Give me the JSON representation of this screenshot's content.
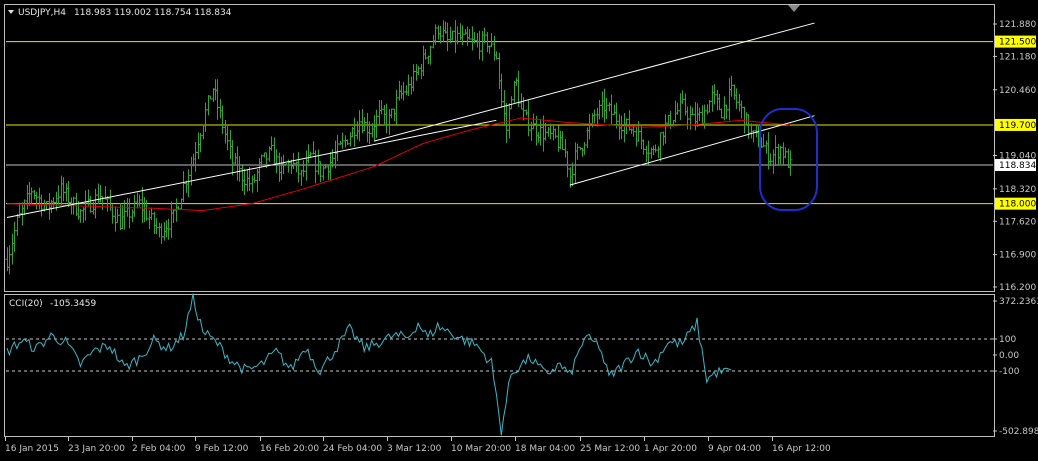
{
  "header": {
    "symbol_timeframe": "USDJPY,H4",
    "ohlc": "118.983 119.002 118.754 118.834"
  },
  "cci_header": {
    "label": "CCI(20)",
    "value": "-105.3459"
  },
  "colors": {
    "background": "#000000",
    "bars": "#2fa52f",
    "ma_line": "#e00000",
    "trend_lines": "#ffffff",
    "support_resistance": "#e6e600",
    "current_price_line": "#c0c0c0",
    "ellipse": "#1a2fd0",
    "cci_line": "#36b9c8",
    "cci_levels": "#c8c8c8",
    "axis_text": "#c8c8c8",
    "highlight_label_bg": "#ffff00",
    "current_label_bg": "#ffffff"
  },
  "chart_data": [
    {
      "type": "ohlc",
      "symbol": "USDJPY",
      "timeframe": "H4",
      "y_axis": {
        "range": [
          116.2,
          121.95
        ],
        "ticks": [
          "121.880",
          "121.180",
          "120.460",
          "119.040",
          "118.320",
          "117.620",
          "116.900",
          "116.200"
        ]
      },
      "x_axis": {
        "ticks": [
          "16 Jan 2015",
          "23 Jan 20:00",
          "2 Feb 04:00",
          "9 Feb 12:00",
          "16 Feb 20:00",
          "24 Feb 04:00",
          "3 Mar 12:00",
          "10 Mar 20:00",
          "18 Mar 04:00",
          "25 Mar 12:00",
          "1 Apr 20:00",
          "9 Apr 04:00",
          "16 Apr 12:00"
        ]
      },
      "horizontal_levels": [
        {
          "label": "121.500",
          "value": 121.5
        },
        {
          "label": "119.700",
          "value": 119.7
        },
        {
          "label": "118.000",
          "value": 118.0
        }
      ],
      "current_price": {
        "label": "118.834",
        "value": 118.834
      },
      "bars_count": 260,
      "price_path": [
        [
          0,
          116.8
        ],
        [
          4,
          117.6
        ],
        [
          10,
          118.3
        ],
        [
          16,
          117.9
        ],
        [
          22,
          118.3
        ],
        [
          30,
          117.8
        ],
        [
          38,
          118.2
        ],
        [
          46,
          117.6
        ],
        [
          54,
          118.0
        ],
        [
          62,
          117.4
        ],
        [
          68,
          117.7
        ],
        [
          72,
          118.4
        ],
        [
          76,
          119.0
        ],
        [
          80,
          119.8
        ],
        [
          84,
          120.5
        ],
        [
          88,
          119.7
        ],
        [
          92,
          118.9
        ],
        [
          96,
          118.6
        ],
        [
          100,
          118.4
        ],
        [
          104,
          118.9
        ],
        [
          108,
          119.1
        ],
        [
          112,
          118.7
        ],
        [
          116,
          118.9
        ],
        [
          120,
          118.6
        ],
        [
          124,
          119.0
        ],
        [
          128,
          118.7
        ],
        [
          132,
          118.9
        ],
        [
          136,
          119.2
        ],
        [
          140,
          119.5
        ],
        [
          144,
          119.8
        ],
        [
          148,
          119.6
        ],
        [
          152,
          119.9
        ],
        [
          156,
          119.8
        ],
        [
          160,
          120.3
        ],
        [
          164,
          120.5
        ],
        [
          168,
          120.9
        ],
        [
          172,
          121.3
        ],
        [
          176,
          121.8
        ],
        [
          180,
          121.5
        ],
        [
          184,
          121.6
        ],
        [
          188,
          121.5
        ],
        [
          192,
          121.45
        ],
        [
          196,
          121.5
        ],
        [
          200,
          121.2
        ],
        [
          202,
          120.2
        ],
        [
          204,
          119.6
        ],
        [
          206,
          120.4
        ],
        [
          208,
          120.6
        ],
        [
          210,
          120.0
        ],
        [
          212,
          119.8
        ],
        [
          216,
          119.6
        ],
        [
          220,
          119.5
        ],
        [
          224,
          119.4
        ],
        [
          228,
          119.1
        ],
        [
          230,
          118.6
        ],
        [
          232,
          119.0
        ],
        [
          236,
          119.4
        ],
        [
          240,
          119.9
        ],
        [
          244,
          120.1
        ],
        [
          248,
          119.9
        ],
        [
          252,
          119.7
        ],
        [
          256,
          119.6
        ],
        [
          260,
          119.3
        ],
        [
          264,
          119.1
        ],
        [
          268,
          119.6
        ],
        [
          272,
          119.9
        ],
        [
          276,
          120.1
        ],
        [
          280,
          119.8
        ],
        [
          284,
          119.9
        ],
        [
          288,
          120.3
        ],
        [
          292,
          120.0
        ],
        [
          296,
          120.4
        ],
        [
          300,
          120.0
        ],
        [
          304,
          119.5
        ],
        [
          308,
          119.3
        ],
        [
          312,
          119.0
        ],
        [
          316,
          119.2
        ],
        [
          320,
          118.8
        ]
      ],
      "moving_average": [
        [
          0,
          118.0
        ],
        [
          60,
          117.9
        ],
        [
          80,
          117.85
        ],
        [
          100,
          118.0
        ],
        [
          120,
          118.3
        ],
        [
          150,
          118.8
        ],
        [
          170,
          119.3
        ],
        [
          190,
          119.6
        ],
        [
          210,
          119.85
        ],
        [
          230,
          119.75
        ],
        [
          260,
          119.65
        ],
        [
          280,
          119.7
        ],
        [
          300,
          119.8
        ],
        [
          320,
          119.7
        ]
      ],
      "trend_lines": [
        {
          "from": [
            0,
            117.7
          ],
          "to": [
            200,
            119.8
          ]
        },
        {
          "from": [
            150,
            119.35
          ],
          "to": [
            330,
            121.9
          ]
        },
        {
          "from": [
            230,
            118.4
          ],
          "to": [
            330,
            119.9
          ]
        }
      ]
    },
    {
      "type": "line",
      "indicator": "CCI(20)",
      "y_axis": {
        "ticks": [
          "372.2363",
          "100",
          "0.00",
          "-100",
          "-502.8983"
        ],
        "range": [
          -502.8983,
          372.2363
        ]
      },
      "levels": [
        100,
        -100
      ],
      "series_path": [
        [
          0,
          20
        ],
        [
          6,
          90
        ],
        [
          12,
          40
        ],
        [
          18,
          120
        ],
        [
          24,
          80
        ],
        [
          30,
          -60
        ],
        [
          36,
          30
        ],
        [
          42,
          60
        ],
        [
          48,
          -80
        ],
        [
          54,
          -20
        ],
        [
          60,
          90
        ],
        [
          66,
          40
        ],
        [
          72,
          120
        ],
        [
          76,
          350
        ],
        [
          80,
          150
        ],
        [
          86,
          70
        ],
        [
          92,
          -40
        ],
        [
          98,
          -100
        ],
        [
          104,
          -60
        ],
        [
          110,
          20
        ],
        [
          116,
          -90
        ],
        [
          122,
          50
        ],
        [
          128,
          -100
        ],
        [
          134,
          30
        ],
        [
          140,
          160
        ],
        [
          146,
          40
        ],
        [
          152,
          80
        ],
        [
          158,
          120
        ],
        [
          164,
          110
        ],
        [
          168,
          200
        ],
        [
          172,
          110
        ],
        [
          176,
          180
        ],
        [
          180,
          150
        ],
        [
          186,
          100
        ],
        [
          192,
          60
        ],
        [
          198,
          -50
        ],
        [
          202,
          -470
        ],
        [
          206,
          -120
        ],
        [
          210,
          -60
        ],
        [
          214,
          -20
        ],
        [
          220,
          -120
        ],
        [
          226,
          -60
        ],
        [
          230,
          -130
        ],
        [
          236,
          110
        ],
        [
          242,
          60
        ],
        [
          246,
          -140
        ],
        [
          252,
          -60
        ],
        [
          258,
          30
        ],
        [
          264,
          -60
        ],
        [
          270,
          80
        ],
        [
          276,
          70
        ],
        [
          282,
          200
        ],
        [
          286,
          -150
        ],
        [
          290,
          -110
        ],
        [
          296,
          -100
        ]
      ]
    }
  ]
}
